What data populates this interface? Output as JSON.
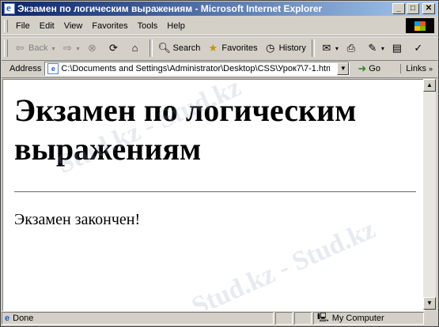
{
  "window": {
    "title": "Экзамен по логическим выражениям - Microsoft Internet Explorer",
    "buttons": {
      "minimize": "_",
      "maximize": "□",
      "close": "✕"
    }
  },
  "menu": [
    "File",
    "Edit",
    "View",
    "Favorites",
    "Tools",
    "Help"
  ],
  "toolbar": {
    "back": "Back",
    "search": "Search",
    "favorites": "Favorites",
    "history": "History"
  },
  "address": {
    "label": "Address",
    "value": "C:\\Documents and Settings\\Administrator\\Desktop\\CSS\\Урок7\\7-1.htm",
    "go": "Go",
    "links": "Links"
  },
  "page": {
    "heading": "Экзамен по логическим выражениям",
    "text": "Экзамен закончен!"
  },
  "watermark": "Stud.kz - Stud.kz",
  "status": {
    "text": "Done",
    "zone": "My Computer"
  }
}
